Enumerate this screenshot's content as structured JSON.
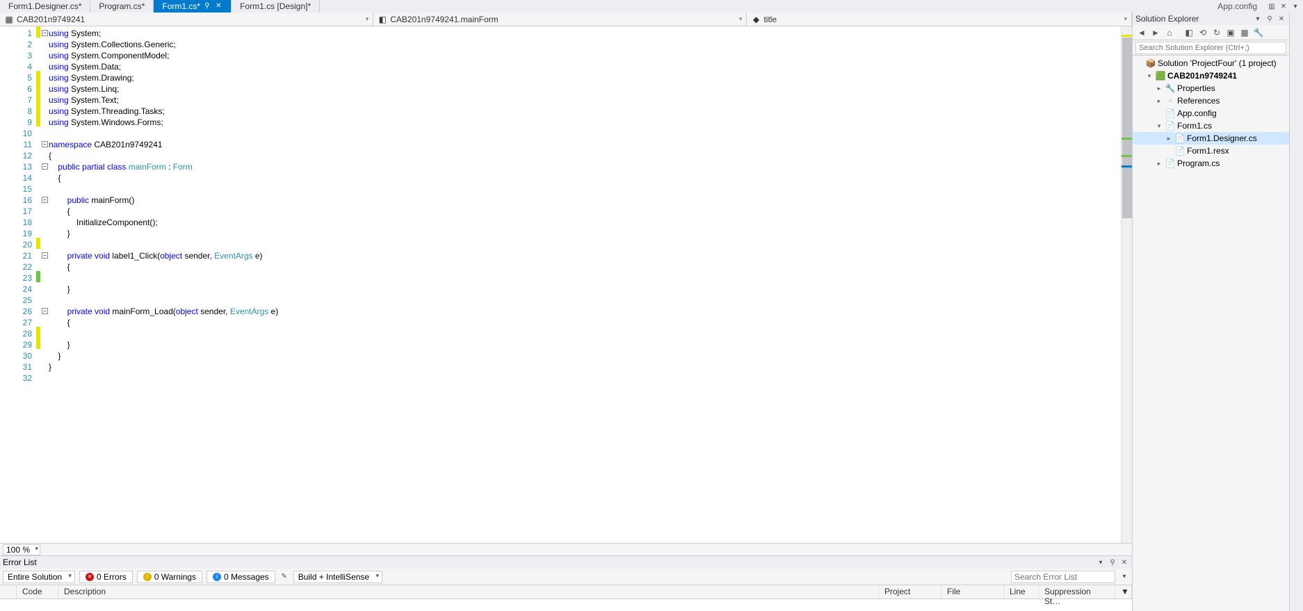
{
  "tabs": [
    {
      "label": "Form1.Designer.cs*"
    },
    {
      "label": "Program.cs*"
    },
    {
      "label": "Form1.cs*",
      "active": true
    },
    {
      "label": "Form1.cs [Design]*"
    }
  ],
  "top_right": {
    "app_config_label": "App.config"
  },
  "navbar": {
    "left": "CAB201n9749241",
    "middle": "CAB201n9749241.mainForm",
    "right": "title"
  },
  "code": {
    "lines": [
      {
        "n": 1,
        "chg": "yellow",
        "html": "<span class='kw'>using</span> System;"
      },
      {
        "n": 2,
        "chg": "",
        "html": "<span class='kw'>using</span> System.Collections.Generic;"
      },
      {
        "n": 3,
        "chg": "",
        "html": "<span class='kw'>using</span> System.ComponentModel;"
      },
      {
        "n": 4,
        "chg": "",
        "html": "<span class='kw'>using</span> System.Data;"
      },
      {
        "n": 5,
        "chg": "yellow",
        "html": "<span class='kw'>using</span> System.Drawing;"
      },
      {
        "n": 6,
        "chg": "yellow",
        "html": "<span class='kw'>using</span> System.Linq;"
      },
      {
        "n": 7,
        "chg": "yellow",
        "html": "<span class='kw'>using</span> System.Text;"
      },
      {
        "n": 8,
        "chg": "yellow",
        "html": "<span class='kw'>using</span> System.Threading.Tasks;"
      },
      {
        "n": 9,
        "chg": "yellow",
        "html": "<span class='kw'>using</span> System.Windows.Forms;"
      },
      {
        "n": 10,
        "chg": "",
        "html": ""
      },
      {
        "n": 11,
        "chg": "",
        "html": "<span class='kw'>namespace</span> CAB201n9749241"
      },
      {
        "n": 12,
        "chg": "",
        "html": "{"
      },
      {
        "n": 13,
        "chg": "",
        "html": "    <span class='kw'>public partial class</span> <span class='type'>mainForm</span> : <span class='type'>Form</span>"
      },
      {
        "n": 14,
        "chg": "",
        "html": "    {"
      },
      {
        "n": 15,
        "chg": "",
        "html": ""
      },
      {
        "n": 16,
        "chg": "",
        "html": "        <span class='kw'>public</span> mainForm()"
      },
      {
        "n": 17,
        "chg": "",
        "html": "        {"
      },
      {
        "n": 18,
        "chg": "",
        "html": "            InitializeComponent();"
      },
      {
        "n": 19,
        "chg": "",
        "html": "        }"
      },
      {
        "n": 20,
        "chg": "yellow",
        "html": ""
      },
      {
        "n": 21,
        "chg": "",
        "html": "        <span class='kw'>private void</span> label1_Click(<span class='kw'>object</span> sender, <span class='type'>EventArgs</span> e)"
      },
      {
        "n": 22,
        "chg": "",
        "html": "        {"
      },
      {
        "n": 23,
        "chg": "green",
        "html": ""
      },
      {
        "n": 24,
        "chg": "",
        "html": "        }"
      },
      {
        "n": 25,
        "chg": "",
        "html": ""
      },
      {
        "n": 26,
        "chg": "",
        "html": "        <span class='kw'>private void</span> mainForm_Load(<span class='kw'>object</span> sender, <span class='type'>EventArgs</span> e)"
      },
      {
        "n": 27,
        "chg": "",
        "html": "        {"
      },
      {
        "n": 28,
        "chg": "yellow",
        "html": ""
      },
      {
        "n": 29,
        "chg": "yellow",
        "html": "        }"
      },
      {
        "n": 30,
        "chg": "",
        "html": "    }"
      },
      {
        "n": 31,
        "chg": "",
        "html": "}"
      },
      {
        "n": 32,
        "chg": "",
        "html": ""
      }
    ],
    "outline_boxes": [
      1,
      11,
      13,
      16,
      21,
      26
    ]
  },
  "zoom": "100 %",
  "solution_explorer": {
    "title": "Solution Explorer",
    "search_placeholder": "Search Solution Explorer (Ctrl+;)",
    "tree": [
      {
        "depth": 0,
        "exp": "",
        "icon": "📦",
        "label": "Solution 'ProjectFour' (1 project)"
      },
      {
        "depth": 1,
        "exp": "▾",
        "icon": "🟩",
        "label": "CAB201n9749241",
        "bold": true
      },
      {
        "depth": 2,
        "exp": "▸",
        "icon": "🔧",
        "label": "Properties"
      },
      {
        "depth": 2,
        "exp": "▸",
        "icon": "▫️",
        "label": "References"
      },
      {
        "depth": 2,
        "exp": "",
        "icon": "📄",
        "label": "App.config"
      },
      {
        "depth": 2,
        "exp": "▾",
        "icon": "📄",
        "label": "Form1.cs"
      },
      {
        "depth": 3,
        "exp": "▸",
        "icon": "📄",
        "label": "Form1.Designer.cs",
        "sel": true
      },
      {
        "depth": 3,
        "exp": "",
        "icon": "📄",
        "label": "Form1.resx"
      },
      {
        "depth": 2,
        "exp": "▸",
        "icon": "📄",
        "label": "Program.cs"
      }
    ]
  },
  "error_list": {
    "title": "Error List",
    "scope": "Entire Solution",
    "errors": "0 Errors",
    "warnings": "0 Warnings",
    "messages": "0 Messages",
    "build_mode": "Build + IntelliSense",
    "search_placeholder": "Search Error List",
    "columns": [
      "",
      "Code",
      "Description",
      "Project",
      "File",
      "Line",
      "Suppression St…",
      ""
    ]
  },
  "side_tab_label": ""
}
